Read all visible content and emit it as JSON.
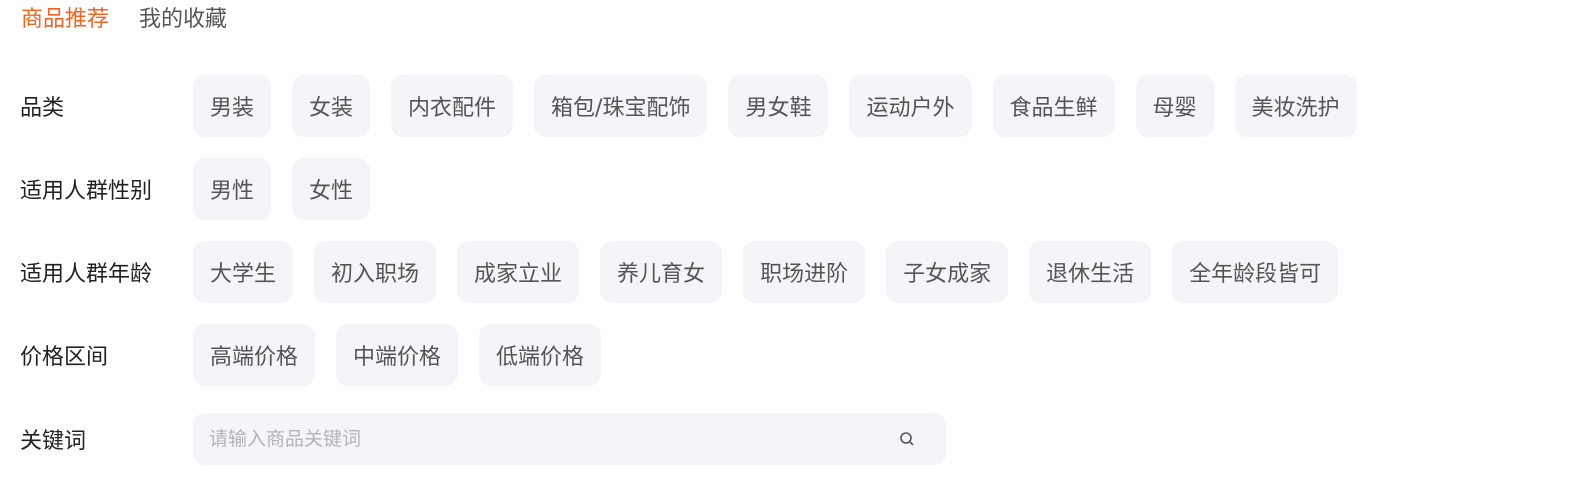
{
  "tabs": [
    {
      "label": "商品推荐",
      "active": true
    },
    {
      "label": "我的收藏",
      "active": false
    }
  ],
  "filters": {
    "category": {
      "label": "品类",
      "options": [
        "男装",
        "女装",
        "内衣配件",
        "箱包/珠宝配饰",
        "男女鞋",
        "运动户外",
        "食品生鲜",
        "母婴",
        "美妆洗护"
      ]
    },
    "gender": {
      "label": "适用人群性别",
      "options": [
        "男性",
        "女性"
      ]
    },
    "age": {
      "label": "适用人群年龄",
      "options": [
        "大学生",
        "初入职场",
        "成家立业",
        "养儿育女",
        "职场进阶",
        "子女成家",
        "退休生活",
        "全年龄段皆可"
      ]
    },
    "price": {
      "label": "价格区间",
      "options": [
        "高端价格",
        "中端价格",
        "低端价格"
      ]
    },
    "keyword": {
      "label": "关键词",
      "placeholder": "请输入商品关键词",
      "value": ""
    }
  },
  "colors": {
    "accent": "#f0641e",
    "chip_bg": "#f4f5f8",
    "text": "#555555"
  },
  "icons": {
    "search": "search-icon"
  }
}
